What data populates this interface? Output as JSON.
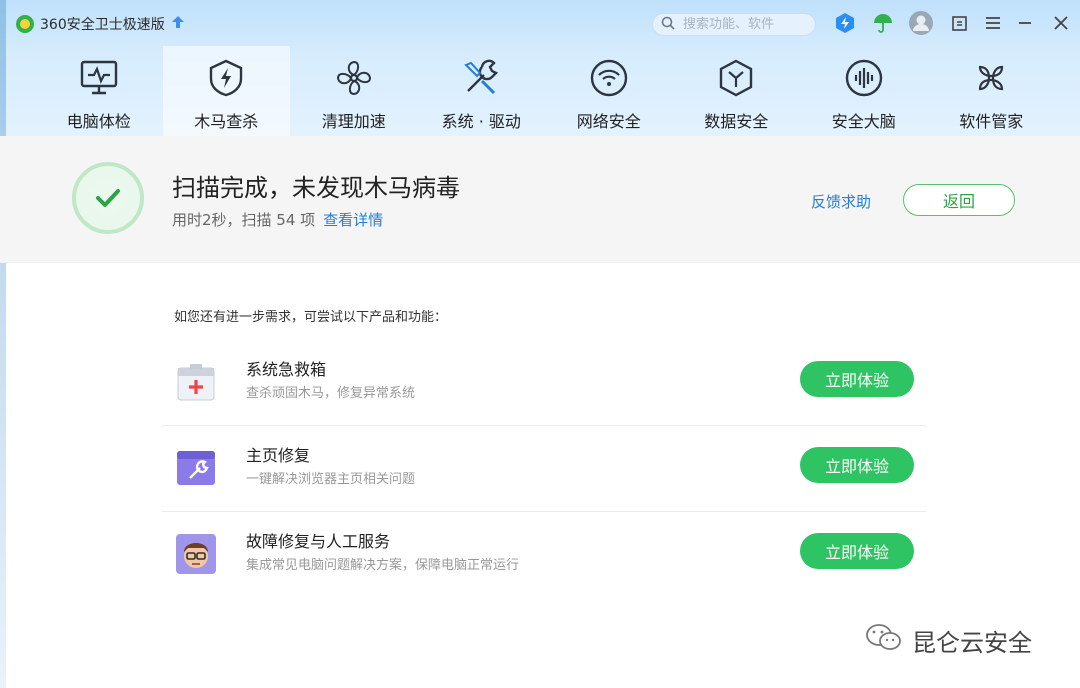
{
  "app": {
    "title": "360安全卫士极速版"
  },
  "search": {
    "placeholder": "搜索功能、软件"
  },
  "nav": {
    "items": [
      {
        "label": "电脑体检",
        "icon": "monitor-pulse-icon"
      },
      {
        "label": "木马查杀",
        "icon": "shield-bolt-icon",
        "active": true
      },
      {
        "label": "清理加速",
        "icon": "fan-icon"
      },
      {
        "label": "系统 · 驱动",
        "icon": "wrench-screwdriver-icon"
      },
      {
        "label": "网络安全",
        "icon": "wifi-icon"
      },
      {
        "label": "数据安全",
        "icon": "hexagon-y-icon"
      },
      {
        "label": "安全大脑",
        "icon": "soundwave-icon"
      },
      {
        "label": "软件管家",
        "icon": "four-petal-icon"
      }
    ]
  },
  "status": {
    "title": "扫描完成，未发现木马病毒",
    "time_text": "用时2秒，扫描 54 项",
    "details_link": "查看详情",
    "feedback": "反馈求助",
    "back": "返回"
  },
  "suggestions": {
    "intro": "如您还有进一步需求，可尝试以下产品和功能：",
    "items": [
      {
        "name": "系统急救箱",
        "desc": "查杀顽固木马，修复异常系统",
        "button": "立即体验",
        "icon": "first-aid-kit-icon"
      },
      {
        "name": "主页修复",
        "desc": "一键解决浏览器主页相关问题",
        "button": "立即体验",
        "icon": "browser-wrench-icon"
      },
      {
        "name": "故障修复与人工服务",
        "desc": "集成常见电脑问题解决方案，保障电脑正常运行",
        "button": "立即体验",
        "icon": "support-agent-icon"
      }
    ]
  },
  "watermark": {
    "text": "昆仑云安全"
  },
  "colors": {
    "accent_green": "#2ec464",
    "link_blue": "#1f7fd9",
    "header_blue": "#cfe8fc"
  }
}
